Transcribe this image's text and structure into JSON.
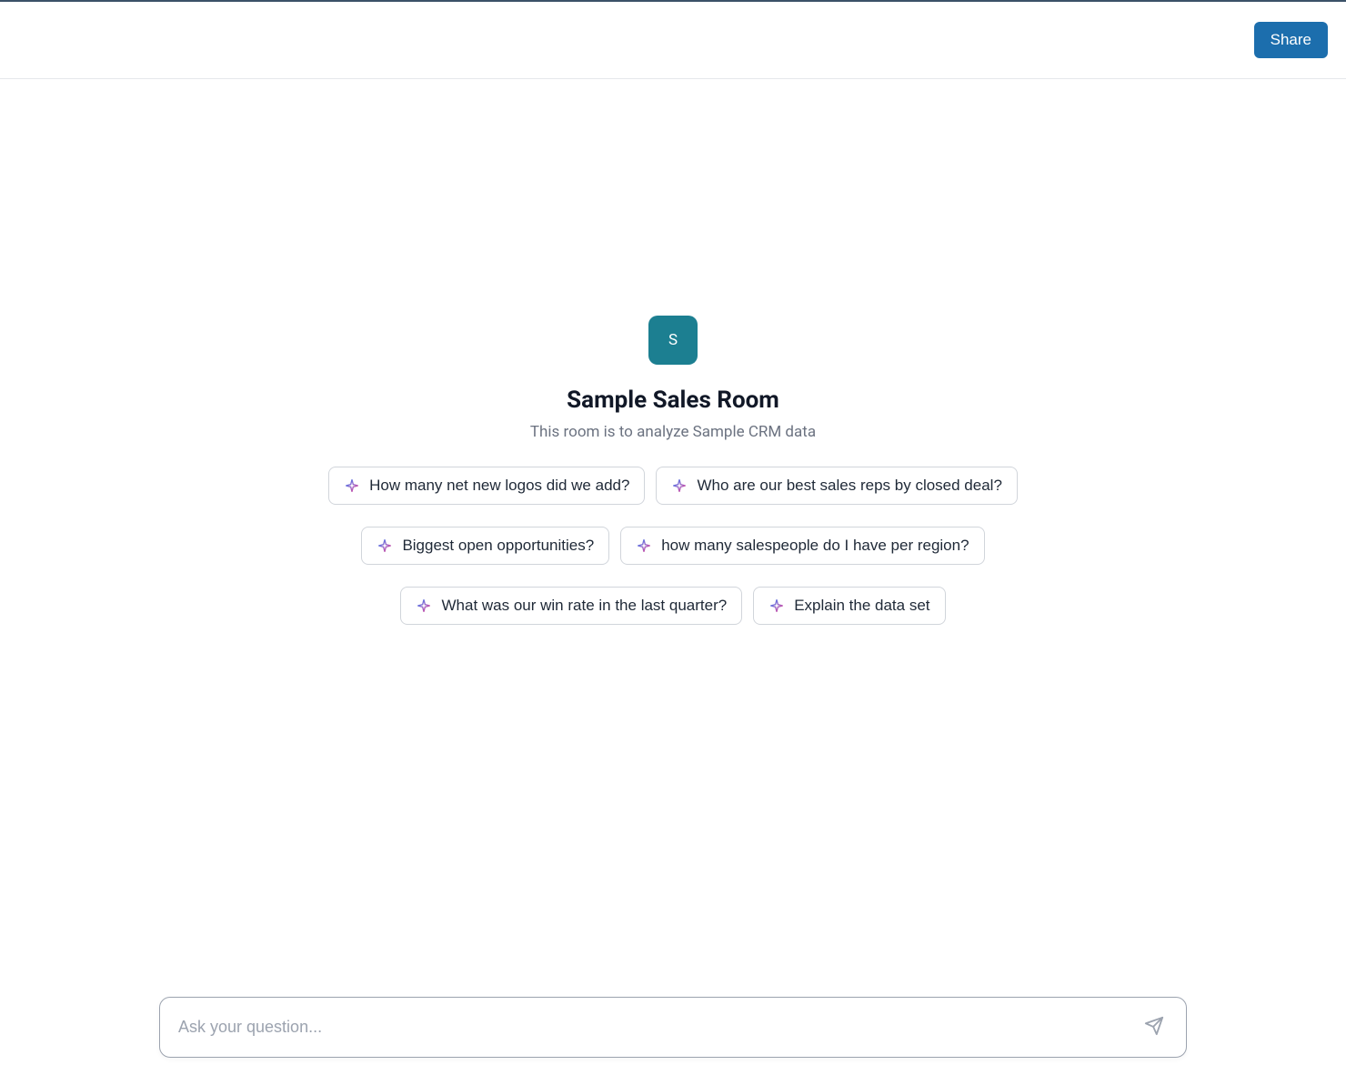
{
  "header": {
    "share_label": "Share"
  },
  "room": {
    "avatar_initial": "S",
    "title": "Sample Sales Room",
    "subtitle": "This room is to analyze Sample CRM data"
  },
  "prompts": [
    "How many net new logos did we add?",
    "Who are our best sales reps by closed deal?",
    "Biggest open opportunities?",
    "how many salespeople do I have per region?",
    "What was our win rate in the last quarter?",
    "Explain the data set"
  ],
  "input": {
    "placeholder": "Ask your question..."
  }
}
